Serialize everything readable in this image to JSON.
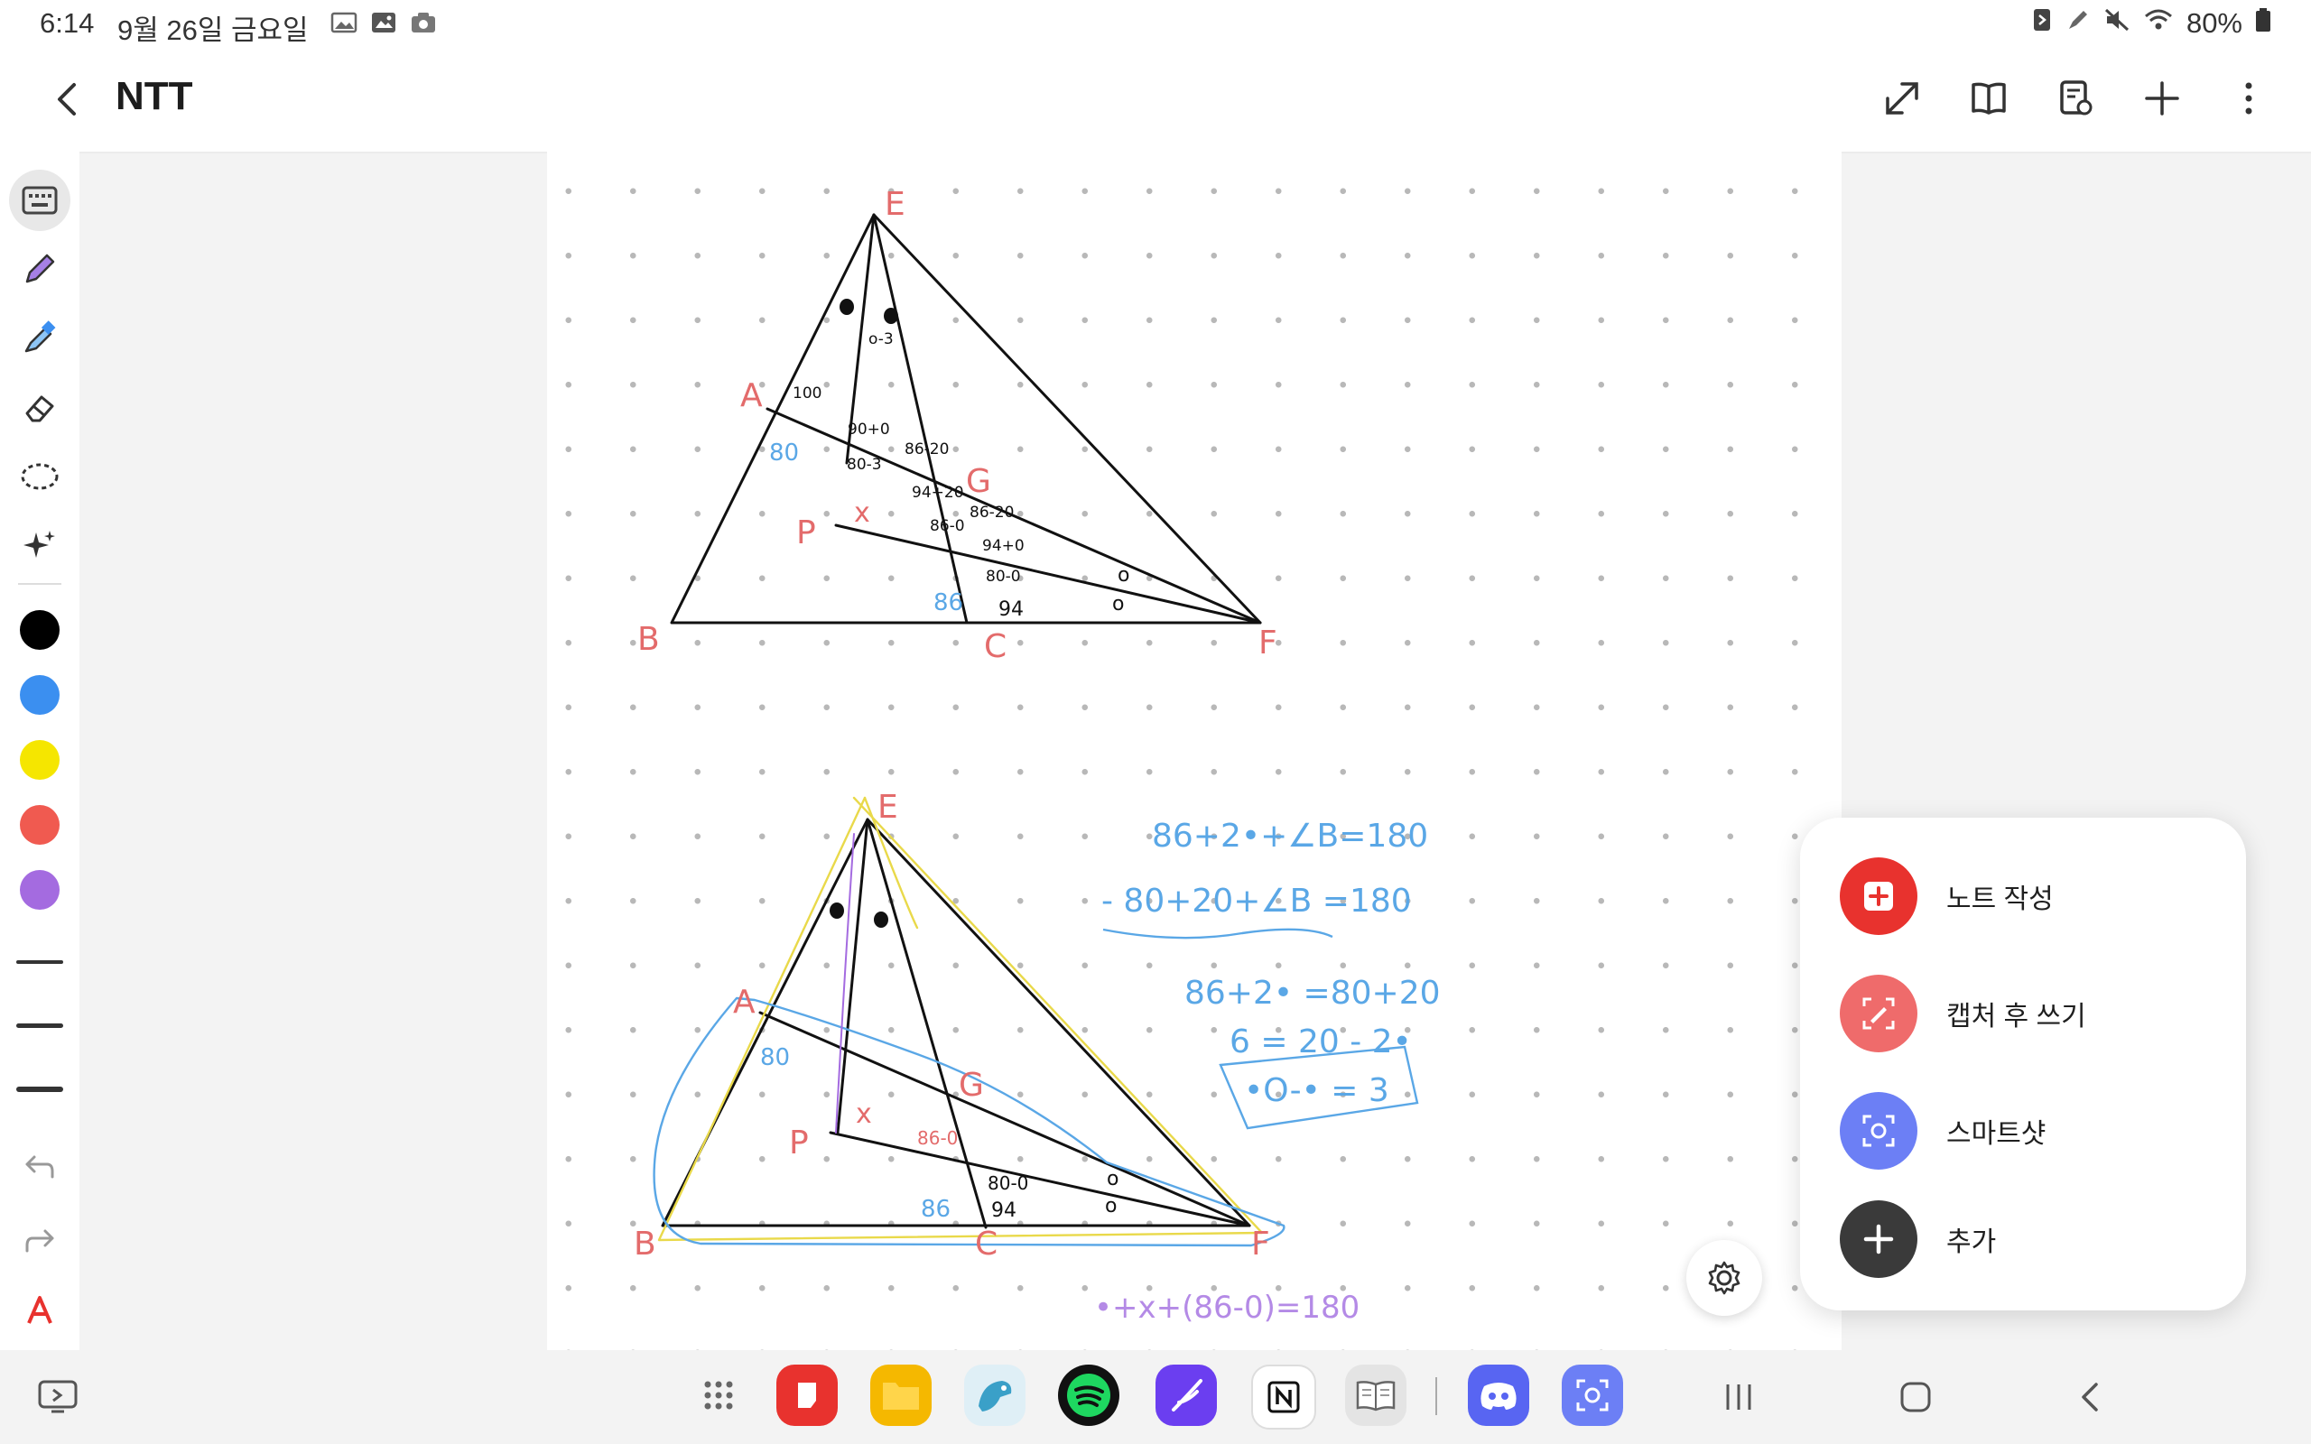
{
  "status_bar": {
    "time": "6:14",
    "date": "9월 26일 금요일",
    "battery": "80%",
    "icons": [
      "gallery-icon",
      "picture-icon",
      "camera-icon",
      "nfc-icon",
      "pen-icon",
      "mute-icon",
      "wifi-icon",
      "battery-icon"
    ]
  },
  "app_bar": {
    "title": "NTT",
    "actions": [
      "expand-icon",
      "book-view-icon",
      "page-settings-icon",
      "add-icon",
      "more-icon"
    ]
  },
  "toolbar": {
    "tools": [
      "keyboard-icon",
      "pen-icon",
      "highlighter-icon",
      "eraser-icon",
      "lasso-icon",
      "ai-sparkle-icon"
    ],
    "colors": [
      "#000000",
      "#3b8ff0",
      "#f5e600",
      "#f05a50",
      "#a46be0"
    ],
    "bottom": [
      "undo-icon",
      "redo-icon",
      "text-style-icon"
    ]
  },
  "canvas": {
    "diagram1": {
      "vertices": [
        "E",
        "A",
        "G",
        "P",
        "B",
        "C",
        "F"
      ],
      "annotations": [
        "100",
        "80",
        "90+0",
        "86-20",
        "80-3",
        "94+20",
        "86-0",
        "86-20",
        "94+0",
        "80-0",
        "86",
        "94",
        "x",
        "o-3",
        "o",
        "o"
      ]
    },
    "diagram2": {
      "vertices": [
        "E",
        "A",
        "G",
        "P",
        "B",
        "C",
        "F"
      ],
      "annotations": [
        "80",
        "x",
        "86-0",
        "86",
        "94",
        "80-0",
        "o",
        "o"
      ]
    },
    "equations": [
      "86+2•+∠B=180",
      "- 80+20+∠B =180",
      "86+2• =80+20",
      "6 = 20 - 2•",
      "•O-• = 3"
    ],
    "purple_line": "•+x+(86-0)=180"
  },
  "popup": {
    "items": [
      {
        "label": "노트 작성",
        "icon": "new-note-icon",
        "color": "#e8322e"
      },
      {
        "label": "캡처 후 쓰기",
        "icon": "capture-write-icon",
        "color": "#ef6b6b"
      },
      {
        "label": "스마트샷",
        "icon": "smart-select-icon",
        "color": "#6c7ff5"
      },
      {
        "label": "추가",
        "icon": "add-icon",
        "color": "#3a3a3a"
      }
    ]
  },
  "nav_bar": {
    "apps": [
      "app-drawer-icon",
      "samsung-notes-icon",
      "my-files-icon",
      "bird-app-icon",
      "spotify-icon",
      "pen-up-icon",
      "notion-icon",
      "reader-icon",
      "discord-icon",
      "smart-select-icon"
    ],
    "buttons": [
      "recents-button",
      "home-button",
      "back-button"
    ]
  }
}
